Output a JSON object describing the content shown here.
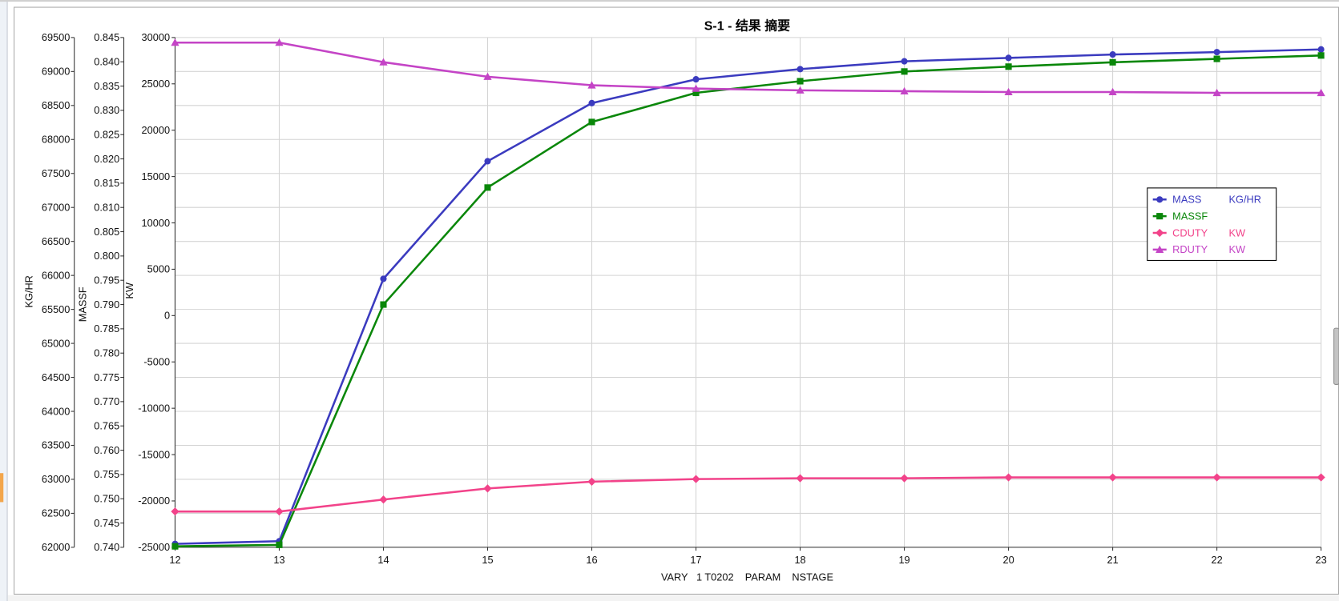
{
  "chart_data": {
    "type": "line",
    "title": "S-1 - 结果 摘要",
    "xlabel": "VARY   1 T0202    PARAM    NSTAGE",
    "x": [
      12,
      13,
      14,
      15,
      16,
      17,
      18,
      19,
      20,
      21,
      22,
      23
    ],
    "xlim": [
      12,
      23
    ],
    "y_axes": [
      {
        "label": "KG/HR",
        "range": [
          62000,
          69500
        ],
        "ticks": [
          "62000",
          "62500",
          "63000",
          "63500",
          "64000",
          "64500",
          "65000",
          "65500",
          "66000",
          "66500",
          "67000",
          "67500",
          "68000",
          "68500",
          "69000",
          "69500"
        ]
      },
      {
        "label": "MASSF",
        "range": [
          0.74,
          0.845
        ],
        "ticks": [
          "0.740",
          "0.745",
          "0.750",
          "0.755",
          "0.760",
          "0.765",
          "0.770",
          "0.775",
          "0.780",
          "0.785",
          "0.790",
          "0.795",
          "0.800",
          "0.805",
          "0.810",
          "0.815",
          "0.820",
          "0.825",
          "0.830",
          "0.835",
          "0.840",
          "0.845"
        ]
      },
      {
        "label": "KW",
        "range": [
          -25000,
          30000
        ],
        "ticks": [
          "-25000",
          "-20000",
          "-15000",
          "-10000",
          "-5000",
          "0",
          "5000",
          "10000",
          "15000",
          "20000",
          "25000",
          "30000"
        ]
      }
    ],
    "series": [
      {
        "name": "MASS",
        "unit": "KG/HR",
        "color": "#3b3bbf",
        "marker": "circle",
        "values": [
          62050,
          62090,
          65950,
          67680,
          68535,
          68885,
          69035,
          69150,
          69200,
          69250,
          69285,
          69325
        ]
      },
      {
        "name": "MASSF",
        "color": "#0a870a",
        "marker": "square",
        "values": [
          0.7402,
          0.7405,
          0.79,
          0.8141,
          0.8276,
          0.8336,
          0.836,
          0.838,
          0.839,
          0.8399,
          0.8406,
          0.8413
        ]
      },
      {
        "name": "CDUTY",
        "unit": "KW",
        "color": "#f2438a",
        "marker": "diamond",
        "values": [
          -21140,
          -21140,
          -19850,
          -18650,
          -17920,
          -17640,
          -17550,
          -17550,
          -17460,
          -17460,
          -17460,
          -17460
        ]
      },
      {
        "name": "RDUTY",
        "unit": "KW",
        "color": "#c444c6",
        "marker": "triangle",
        "values": [
          29450,
          29450,
          27340,
          25770,
          24850,
          24490,
          24300,
          24210,
          24120,
          24120,
          24030,
          24030
        ]
      }
    ],
    "grid": true,
    "legend": "right"
  }
}
